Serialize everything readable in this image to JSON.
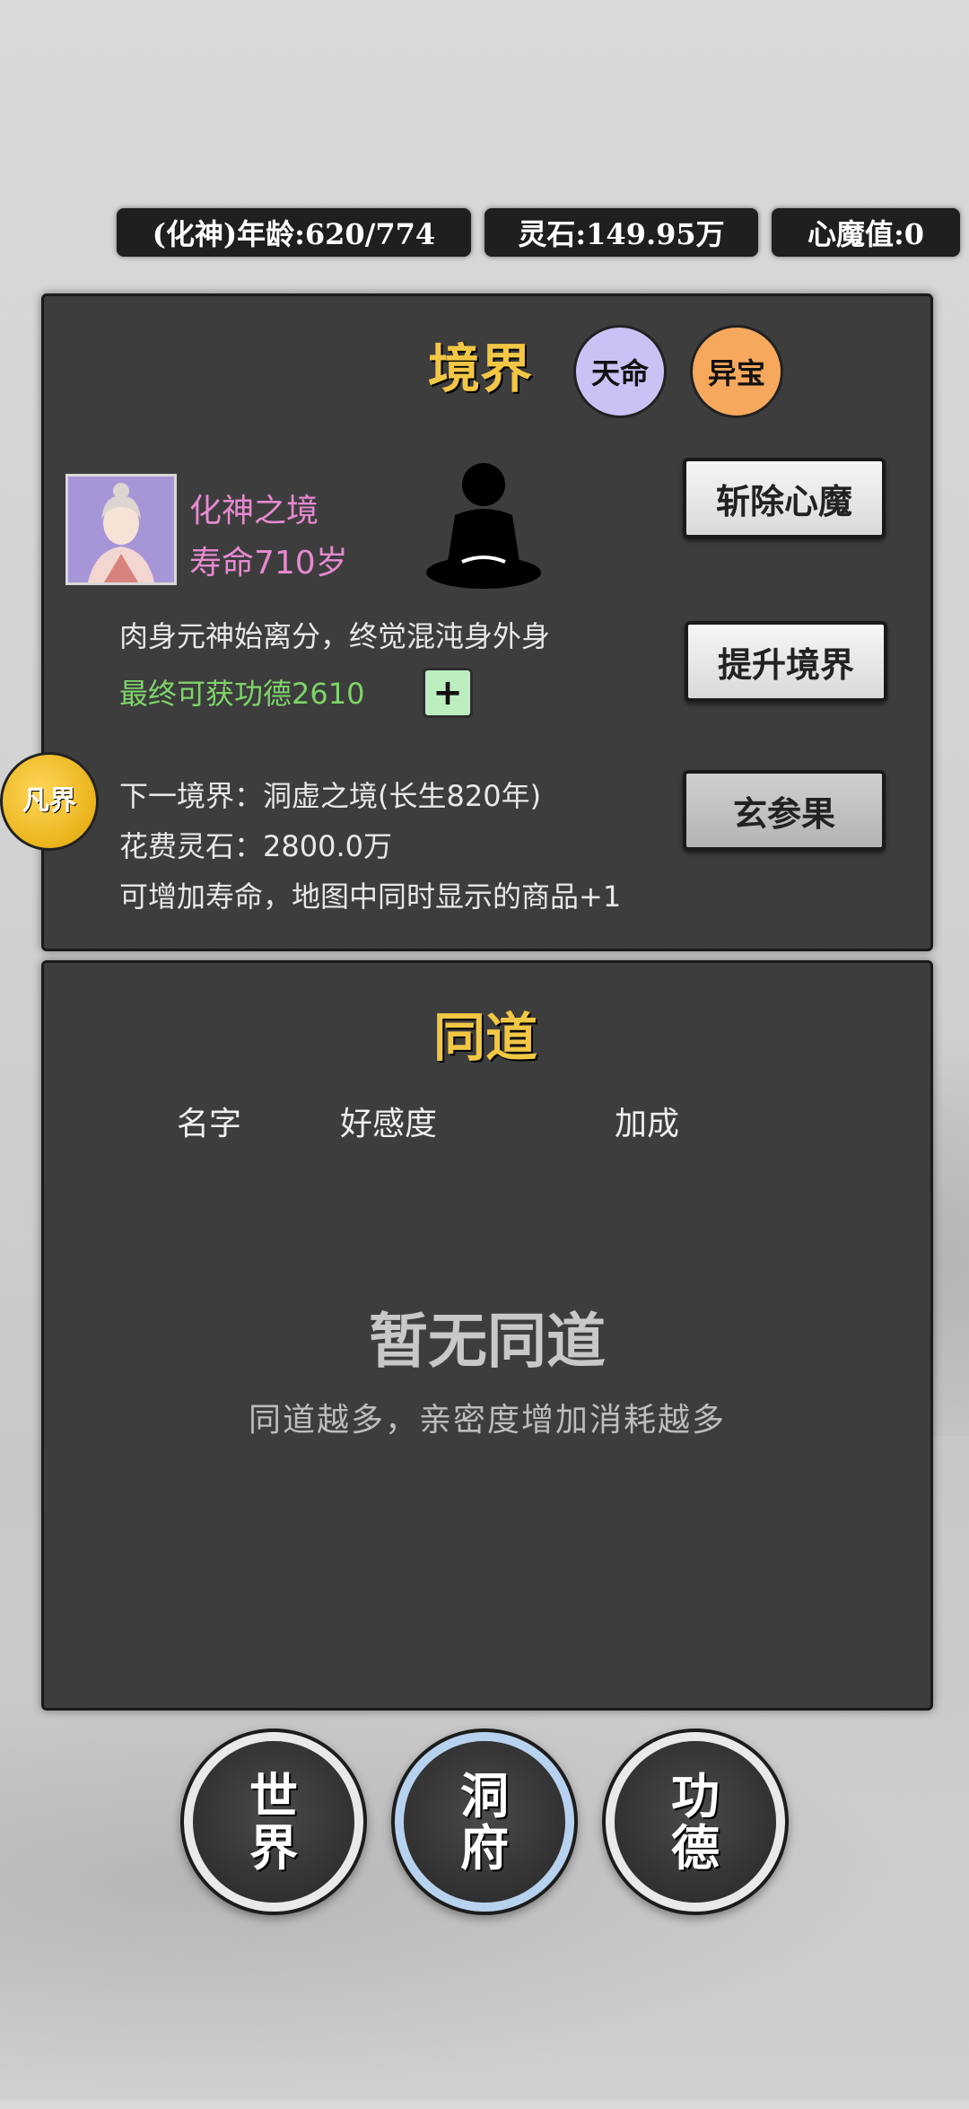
{
  "header": {
    "age": "(化神)年龄:620/774",
    "spirit_stone": "灵石:149.95万",
    "demon_value": "心魔值:0"
  },
  "realm_panel": {
    "title": "境界",
    "destiny_button": "天命",
    "treasure_button": "异宝",
    "realm_name": "化神之境",
    "lifespan": "寿命710岁",
    "description": "肉身元神始离分，终觉混沌身外身",
    "merit": "最终可获功德2610",
    "plus_label": "+",
    "next_realm": "下一境界：洞虚之境(长生820年)",
    "cost": "花费灵石：2800.0万",
    "bonus": "可增加寿命，地图中同时显示的商品+1",
    "buttons": {
      "slay_demon": "斩除心魔",
      "upgrade": "提升境界",
      "fruit": "玄参果"
    },
    "side_badge": "凡界"
  },
  "companion_panel": {
    "title": "同道",
    "columns": [
      "名字",
      "好感度",
      "加成"
    ],
    "empty_title": "暂无同道",
    "empty_subtitle": "同道越多，亲密度增加消耗越多"
  },
  "bottom_nav": {
    "world": "世界",
    "cave": "洞府",
    "merit": "功德"
  },
  "colors": {
    "gold": "#f2c744",
    "pink": "#e68ad0",
    "green": "#7fd46a",
    "destiny": "#c9c3f5",
    "treasure": "#f6a85c"
  }
}
